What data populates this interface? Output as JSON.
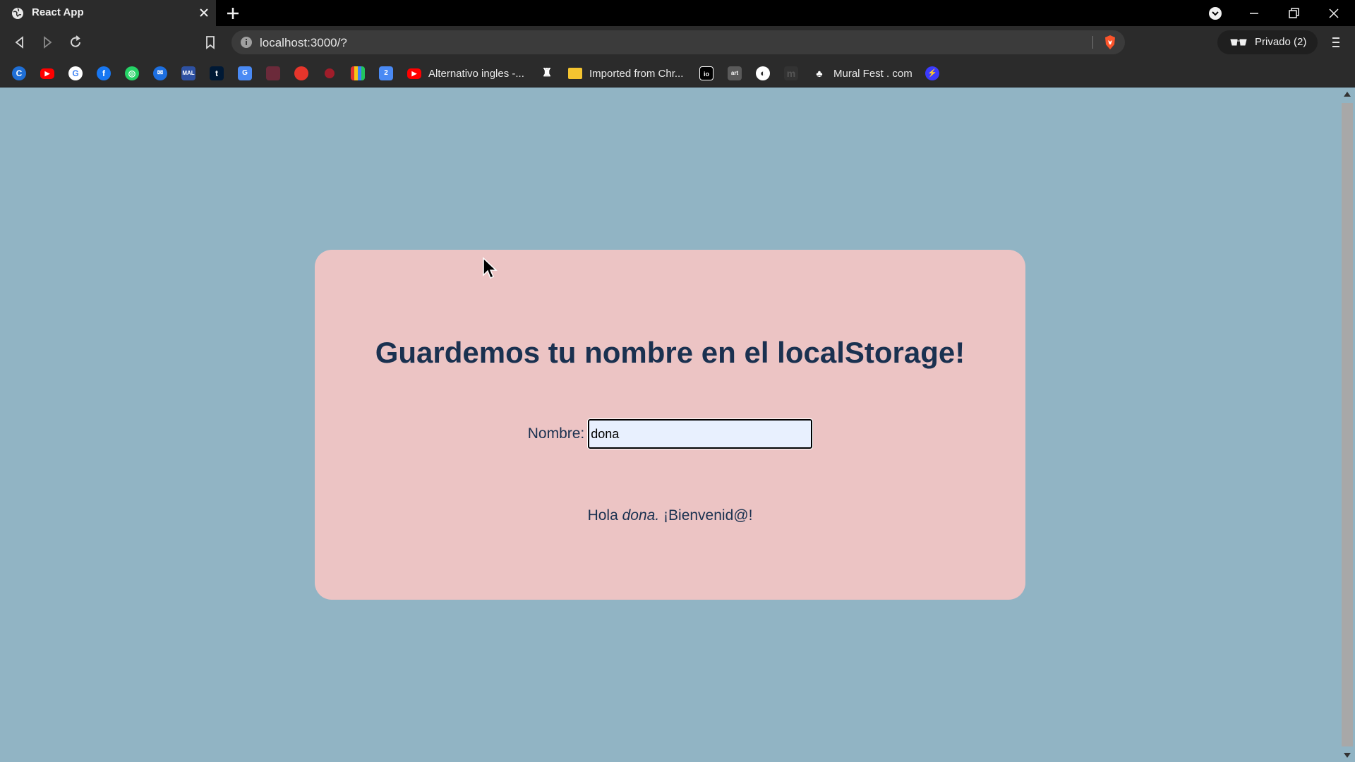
{
  "browser": {
    "tab_title": "React App",
    "url": "localhost:3000/?",
    "private_label": "Privado (2)",
    "bookmarks": [
      {
        "icon": "c-icon",
        "label": ""
      },
      {
        "icon": "youtube-icon",
        "label": ""
      },
      {
        "icon": "google-icon",
        "label": ""
      },
      {
        "icon": "facebook-icon",
        "label": ""
      },
      {
        "icon": "whatsapp-icon",
        "label": ""
      },
      {
        "icon": "messenger-icon",
        "label": ""
      },
      {
        "icon": "mal-icon",
        "label": ""
      },
      {
        "icon": "tumblr-icon",
        "label": ""
      },
      {
        "icon": "translate-icon",
        "label": ""
      },
      {
        "icon": "game-icon",
        "label": ""
      },
      {
        "icon": "reddit-like-icon",
        "label": ""
      },
      {
        "icon": "red-app-icon",
        "label": ""
      },
      {
        "icon": "bars-icon",
        "label": ""
      },
      {
        "icon": "calendar-icon",
        "label": ""
      },
      {
        "icon": "youtube-icon",
        "label": "Alternativo ingles -..."
      },
      {
        "icon": "ghost-icon",
        "label": ""
      },
      {
        "icon": "folder-icon",
        "label": "Imported from Chr..."
      },
      {
        "icon": "io-icon",
        "label": ""
      },
      {
        "icon": "art-icon",
        "label": ""
      },
      {
        "icon": "globe-icon",
        "label": ""
      },
      {
        "icon": "m-icon",
        "label": ""
      },
      {
        "icon": "mural-icon",
        "label": "Mural Fest . com"
      },
      {
        "icon": "bolt-icon",
        "label": ""
      }
    ]
  },
  "page": {
    "title": "Guardemos tu nombre en el localStorage!",
    "name_label": "Nombre:",
    "name_value": "dona",
    "greeting_prefix": "Hola",
    "greeting_name": "dona.",
    "greeting_suffix": "¡Bienvenid@!"
  },
  "colors": {
    "background": "#91b4c4",
    "card": "#ecc4c4",
    "text": "#1a3150"
  }
}
